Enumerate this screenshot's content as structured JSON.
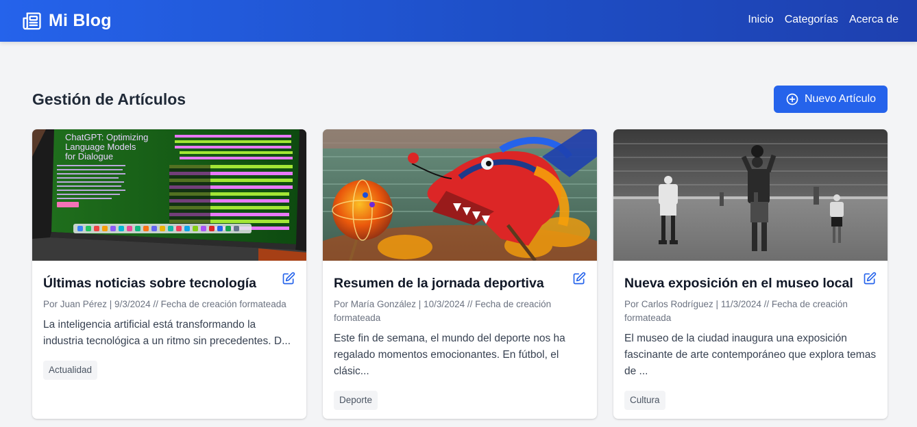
{
  "header": {
    "brand": "Mi Blog",
    "brand_icon": "newspaper-icon",
    "nav": [
      "Inicio",
      "Categorías",
      "Acerca de"
    ]
  },
  "page": {
    "title": "Gestión de Artículos",
    "new_button": "Nuevo Artículo",
    "new_button_icon": "plus-circle-icon"
  },
  "articles": [
    {
      "title": "Últimas noticias sobre tecnología",
      "meta": "Por Juan Pérez | 9/3/2024 // Fecha de creación formateada",
      "excerpt": "La inteligencia artificial está transformando la industria tecnológica a un ritmo sin precedentes. D...",
      "category": "Actualidad",
      "image_alt": "Laptop showing ChatGPT webpage",
      "image_text": [
        "ChatGPT: Optimizing",
        "Language Models",
        "for Dialogue"
      ]
    },
    {
      "title": "Resumen de la jornada deportiva",
      "meta": "Por María González | 10/3/2024 // Fecha de creación formateada",
      "excerpt": "Este fin de semana, el mundo del deporte nos ha regalado momentos emocionantes. En fútbol, el clásic...",
      "category": "Deporte",
      "image_alt": "Chinese dragon dance"
    },
    {
      "title": "Nueva exposición en el museo local",
      "meta": "Por Carlos Rodríguez | 11/3/2024 // Fecha de creación formateada",
      "excerpt": "El museo de la ciudad inaugura una exposición fascinante de arte contemporáneo que explora temas de ...",
      "category": "Cultura",
      "image_alt": "Black and white football match photo"
    }
  ],
  "colors": {
    "primary": "#2563eb",
    "header_end": "#1e40af",
    "background": "#f3f4f6"
  },
  "edit_icon": "edit-icon"
}
